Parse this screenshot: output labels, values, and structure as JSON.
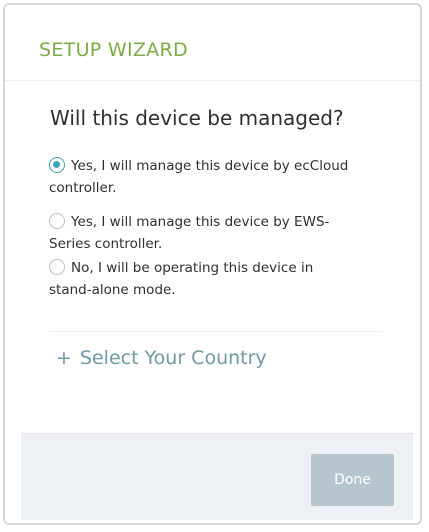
{
  "wizard": {
    "title": "SETUP WIZARD",
    "question": "Will this device be managed?",
    "options": [
      {
        "label": "Yes, I will manage this device by ecCloud controller.",
        "selected": true
      },
      {
        "label": "Yes, I will manage this device by EWS-Series controller.",
        "selected": false
      },
      {
        "label": "No, I will be operating this device in stand-alone mode.",
        "selected": false
      }
    ],
    "country_link": {
      "icon": "plus-icon",
      "symbol": "+",
      "label": "Select Your Country"
    },
    "done_label": "Done"
  },
  "colors": {
    "title_green": "#7bab45",
    "radio_teal": "#3aa5b8",
    "link_teal": "#6e9aa3",
    "footer_bg": "#edf1f6",
    "button_disabled": "#b7c5cc"
  }
}
